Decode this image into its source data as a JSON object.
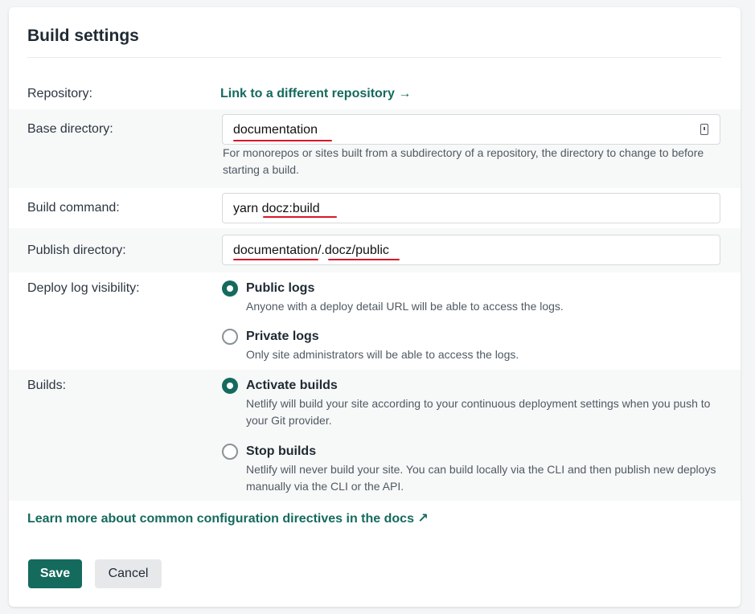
{
  "header": {
    "title": "Build settings"
  },
  "repository": {
    "label": "Repository:",
    "link": "Link to a different repository →"
  },
  "base_directory": {
    "label": "Base directory:",
    "value": "documentation",
    "help": "For monorepos or sites built from a subdirectory of a repository, the directory to change to before starting a build.",
    "icon": "lock-icon"
  },
  "build_command": {
    "label": "Build command:",
    "value": "yarn docz:build"
  },
  "publish_directory": {
    "label": "Publish directory:",
    "value": "documentation/.docz/public"
  },
  "deploy_log_visibility": {
    "label": "Deploy log visibility:",
    "options": [
      {
        "title": "Public logs",
        "desc": "Anyone with a deploy detail URL will be able to access the logs.",
        "selected": true
      },
      {
        "title": "Private logs",
        "desc": "Only site administrators will be able to access the logs.",
        "selected": false
      }
    ]
  },
  "builds": {
    "label": "Builds:",
    "options": [
      {
        "title": "Activate builds",
        "desc": "Netlify will build your site according to your continuous deployment settings when you push to your Git provider.",
        "selected": true
      },
      {
        "title": "Stop builds",
        "desc": "Netlify will never build your site. You can build locally via the CLI and then publish new deploys manually via the CLI or the API.",
        "selected": false
      }
    ]
  },
  "docs_link": "Learn more about common configuration directives in the docs ↗",
  "actions": {
    "save": "Save",
    "cancel": "Cancel"
  },
  "colors": {
    "accent": "#156a5e",
    "annotation": "#d8162a",
    "shaded_row": "#f7f8f8"
  }
}
